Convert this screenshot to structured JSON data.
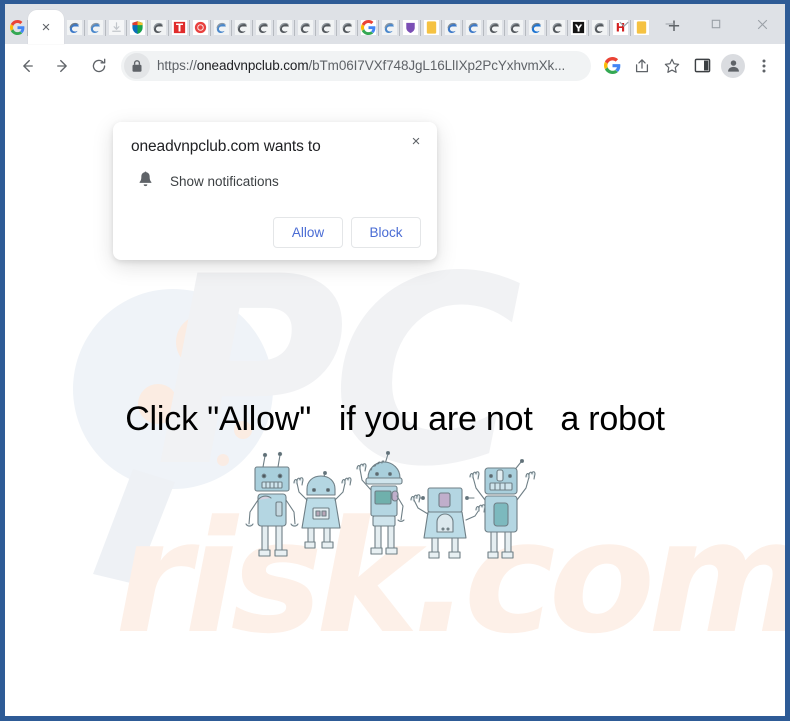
{
  "window": {
    "controls": [
      {
        "name": "tab-search",
        "glyph": "chevron-down-icon"
      },
      {
        "name": "minimize",
        "glyph": "minimize-icon"
      },
      {
        "name": "maximize",
        "glyph": "maximize-icon"
      },
      {
        "name": "close",
        "glyph": "close-icon"
      }
    ],
    "frame_color": "#2e5b96"
  },
  "tabs": {
    "new_tab_label": "+",
    "active_close_label": "×",
    "items": [
      {
        "favicon": "google-g-icon",
        "active": false
      },
      {
        "favicon": "active-tab-close-icon",
        "active": true
      },
      {
        "favicon": "edge-icon",
        "active": false
      },
      {
        "favicon": "edge-icon",
        "active": false
      },
      {
        "favicon": "download-icon",
        "active": false
      },
      {
        "favicon": "shield-icon",
        "active": false
      },
      {
        "favicon": "edge-dark-icon",
        "active": false
      },
      {
        "favicon": "red-t-icon",
        "active": false
      },
      {
        "favicon": "red-circle-icon",
        "active": false
      },
      {
        "favicon": "edge-icon",
        "active": false
      },
      {
        "favicon": "edge-dark-icon",
        "active": false
      },
      {
        "favicon": "edge-dark-icon",
        "active": false
      },
      {
        "favicon": "edge-dark-icon",
        "active": false
      },
      {
        "favicon": "edge-dark-icon",
        "active": false
      },
      {
        "favicon": "edge-dark-icon",
        "active": false
      },
      {
        "favicon": "edge-dark-icon",
        "active": false
      },
      {
        "favicon": "google-g-icon",
        "active": false
      },
      {
        "favicon": "edge-icon",
        "active": false
      },
      {
        "favicon": "purple-shield-icon",
        "active": false
      },
      {
        "favicon": "yellow-square-icon",
        "active": false
      },
      {
        "favicon": "edge-icon",
        "active": false
      },
      {
        "favicon": "edge-icon",
        "active": false
      },
      {
        "favicon": "edge-dark-icon",
        "active": false
      },
      {
        "favicon": "edge-dark-icon",
        "active": false
      },
      {
        "favicon": "edge-icon",
        "active": false
      },
      {
        "favicon": "edge-dark-icon",
        "active": false
      },
      {
        "favicon": "yahoo-y-icon",
        "active": false
      },
      {
        "favicon": "edge-dark-icon",
        "active": false
      },
      {
        "favicon": "red-h-icon",
        "active": false
      },
      {
        "favicon": "yellow-square-icon",
        "active": false
      }
    ]
  },
  "toolbar": {
    "back_label": "back-icon",
    "forward_label": "forward-icon",
    "reload_label": "reload-icon",
    "lock_label": "lock-icon",
    "url_scheme": "https://",
    "url_host": "oneadvnpclub.com",
    "url_path": "/bTm06I7VXf748JgL16LlIXp2PcYxhvmXk...",
    "url_full": "https://oneadvnpclub.com/bTm06I7VXf748JgL16LlIXp2PcYxhvmXk...",
    "right_icons": [
      {
        "name": "google-g-icon"
      },
      {
        "name": "share-icon"
      },
      {
        "name": "bookmark-star-icon"
      },
      {
        "name": "side-panel-icon"
      },
      {
        "name": "profile-avatar-icon"
      },
      {
        "name": "more-menu-icon"
      }
    ]
  },
  "dialog": {
    "title": "oneadvnpclub.com wants to",
    "permission_icon": "bell-icon",
    "permission_label": "Show notifications",
    "allow_label": "Allow",
    "block_label": "Block",
    "close_label": "×",
    "accent_color": "#4a6cd4"
  },
  "page": {
    "headline": "Click \"Allow\"   if you are not   a robot",
    "watermark_pc": "PC",
    "watermark_risk": "risk.com",
    "illustration": "five-cartoon-robots",
    "background_color": "#ffffff",
    "headline_color": "#000000",
    "watermark_gray": "#f1f2f4",
    "watermark_peach": "#fdf0e8"
  }
}
